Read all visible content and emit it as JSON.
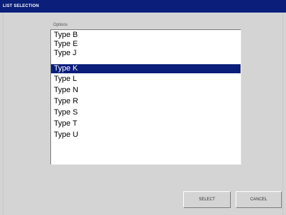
{
  "window": {
    "title": "LIST SELECTION"
  },
  "options": {
    "label": "Options",
    "items": [
      {
        "label": "Type B",
        "selected": false
      },
      {
        "label": "Type E",
        "selected": false
      },
      {
        "label": "Type J",
        "selected": false
      },
      {
        "label": "Type K",
        "selected": true
      },
      {
        "label": "Type L",
        "selected": false
      },
      {
        "label": "Type N",
        "selected": false
      },
      {
        "label": "Type R",
        "selected": false
      },
      {
        "label": "Type S",
        "selected": false
      },
      {
        "label": "Type T",
        "selected": false
      },
      {
        "label": "Type U",
        "selected": false
      }
    ]
  },
  "buttons": {
    "select_label": "SELECT",
    "cancel_label": "CANCEL"
  },
  "colors": {
    "titlebar": "#0a1e7a",
    "selection": "#0a1e7a",
    "background": "#d4d4d4"
  }
}
